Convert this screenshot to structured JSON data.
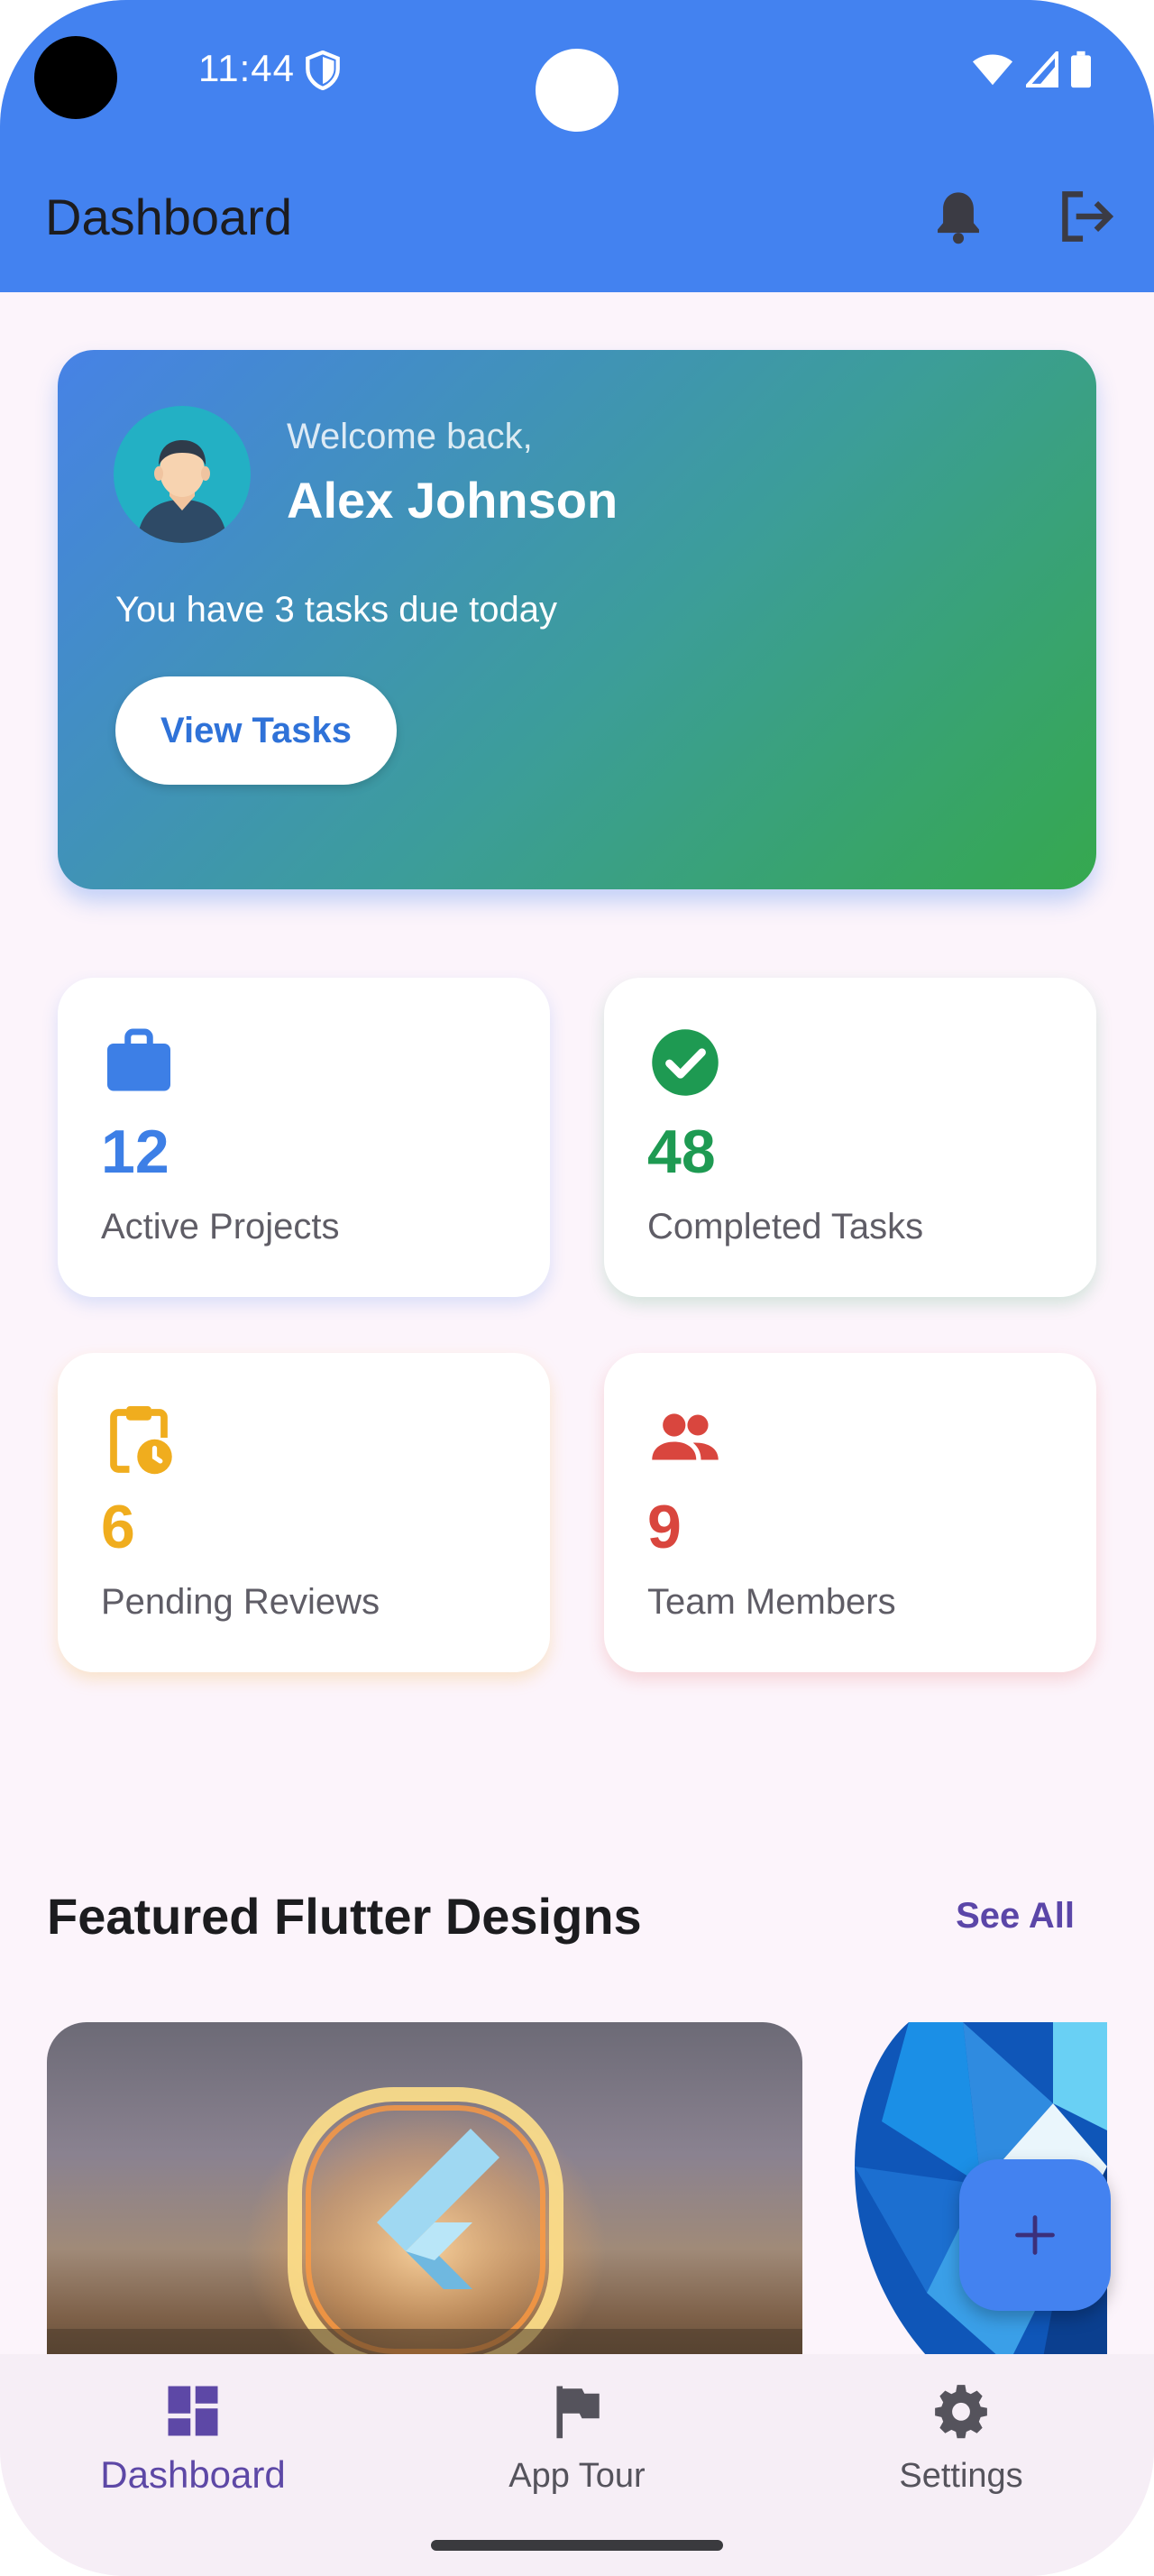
{
  "status_bar": {
    "time": "11:44"
  },
  "app_bar": {
    "title": "Dashboard"
  },
  "welcome": {
    "greeting": "Welcome back,",
    "name": "Alex Johnson",
    "subtitle": "You have 3 tasks due today",
    "button_label": "View Tasks"
  },
  "stats": [
    {
      "value": "12",
      "label": "Active Projects",
      "color": "#3d7fe6",
      "icon": "briefcase-icon"
    },
    {
      "value": "48",
      "label": "Completed Tasks",
      "color": "#1e9a52",
      "icon": "check-circle-icon"
    },
    {
      "value": "6",
      "label": "Pending Reviews",
      "color": "#f0ad1e",
      "icon": "clipboard-clock-icon"
    },
    {
      "value": "9",
      "label": "Team Members",
      "color": "#d9463e",
      "icon": "group-icon"
    }
  ],
  "featured": {
    "title": "Featured Flutter Designs",
    "see_all": "See All"
  },
  "bottom_nav": {
    "items": [
      {
        "label": "Dashboard",
        "icon": "dashboard-icon",
        "active": true
      },
      {
        "label": "App Tour",
        "icon": "flag-icon",
        "active": false
      },
      {
        "label": "Settings",
        "icon": "gear-icon",
        "active": false
      }
    ]
  },
  "colors": {
    "primary": "#4382f0",
    "accent": "#5d48a6",
    "background": "#fcf4fb"
  }
}
